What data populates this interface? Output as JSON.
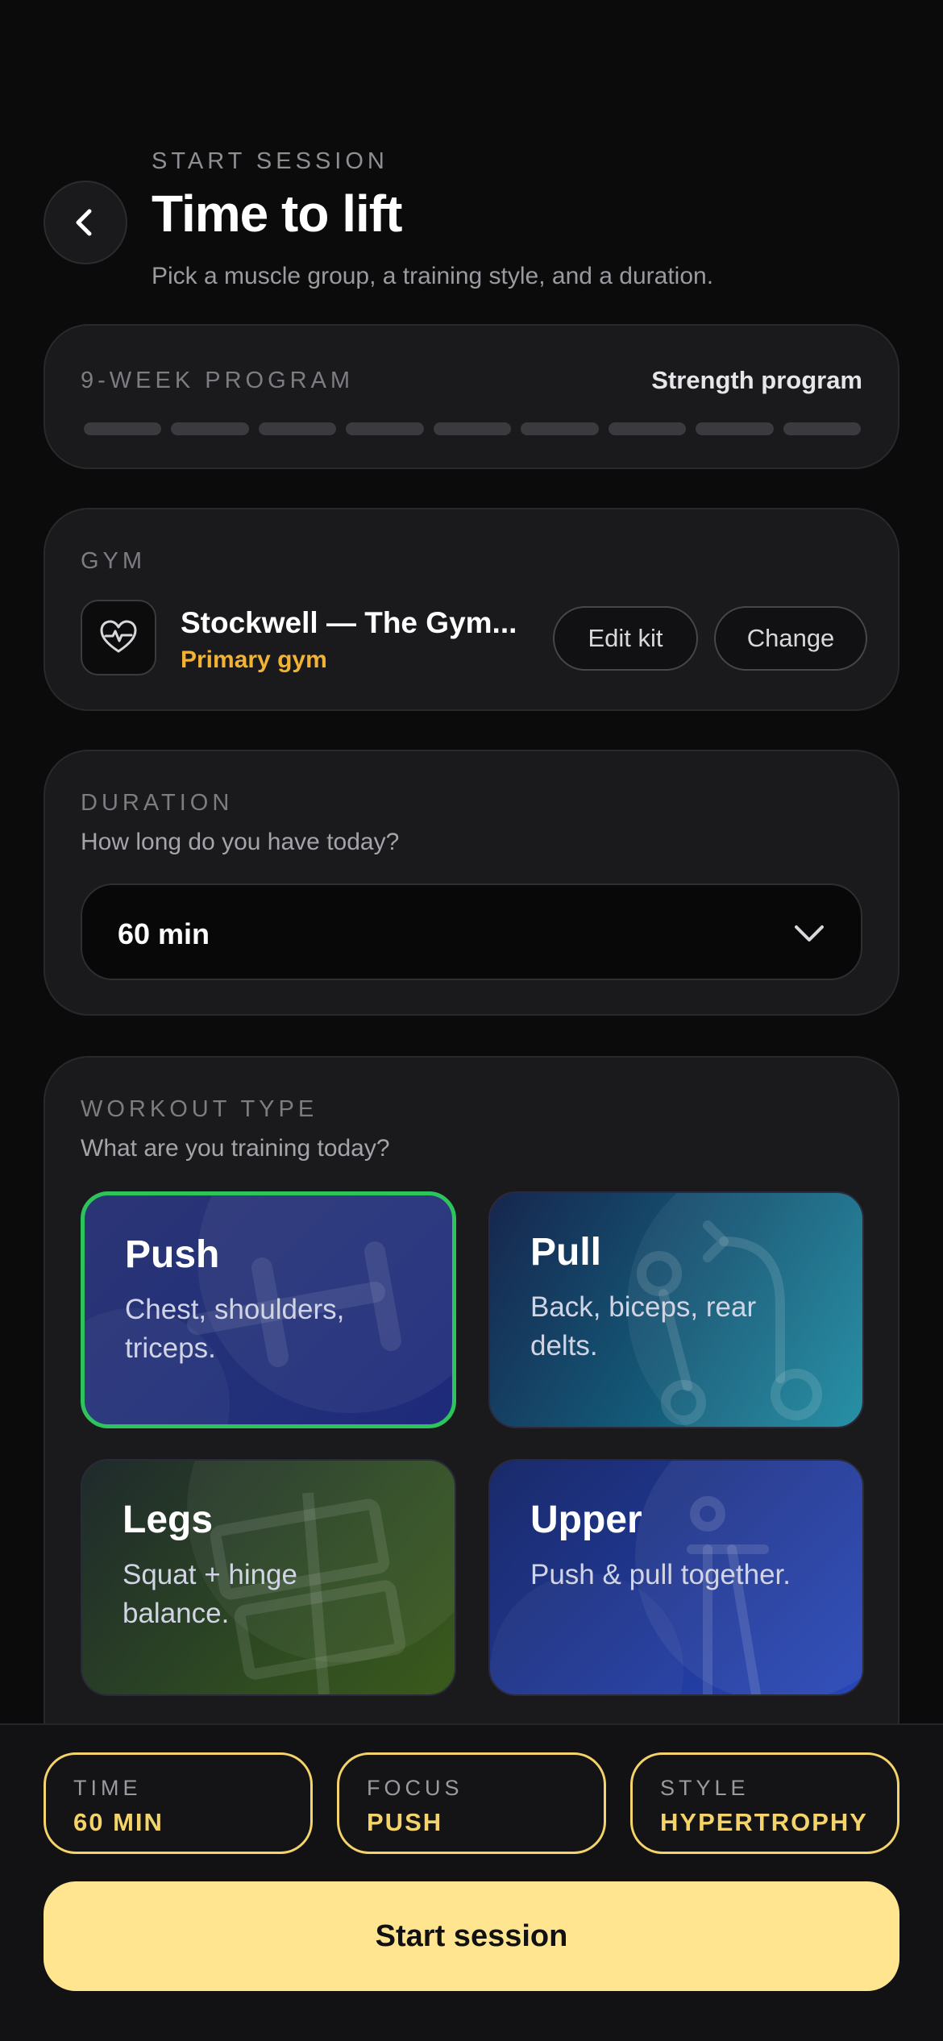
{
  "header": {
    "eyebrow": "START SESSION",
    "title": "Time to lift",
    "subtitle": "Pick a muscle group, a training style, and a duration.",
    "back_icon": "chevron-left-icon"
  },
  "program": {
    "label": "9-WEEK PROGRAM",
    "name": "Strength program",
    "weeks_total": 9,
    "weeks_completed": 0
  },
  "gym": {
    "label": "GYM",
    "name": "Stockwell — The Gym...",
    "subtitle": "Primary gym",
    "icon": "heart-pulse-icon",
    "edit_label": "Edit kit",
    "change_label": "Change"
  },
  "duration": {
    "label": "DURATION",
    "hint": "How long do you have today?",
    "selected": "60 min"
  },
  "workout_type": {
    "label": "WORKOUT TYPE",
    "hint": "What are you training today?",
    "options": [
      {
        "title": "Push",
        "desc": "Chest, shoulders, triceps.",
        "selected": true
      },
      {
        "title": "Pull",
        "desc": "Back, biceps, rear delts.",
        "selected": false
      },
      {
        "title": "Legs",
        "desc": "Squat + hinge balance.",
        "selected": false
      },
      {
        "title": "Upper",
        "desc": "Push & pull together.",
        "selected": false
      }
    ]
  },
  "summary": {
    "time_label": "TIME",
    "time_value": "60 MIN",
    "focus_label": "FOCUS",
    "focus_value": "PUSH",
    "style_label": "STYLE",
    "style_value": "HYPERTROPHY"
  },
  "start_label": "Start session",
  "colors": {
    "accent_yellow": "#ffe58f",
    "selected_green": "#2ec45c",
    "gym_sub": "#f2b233"
  }
}
